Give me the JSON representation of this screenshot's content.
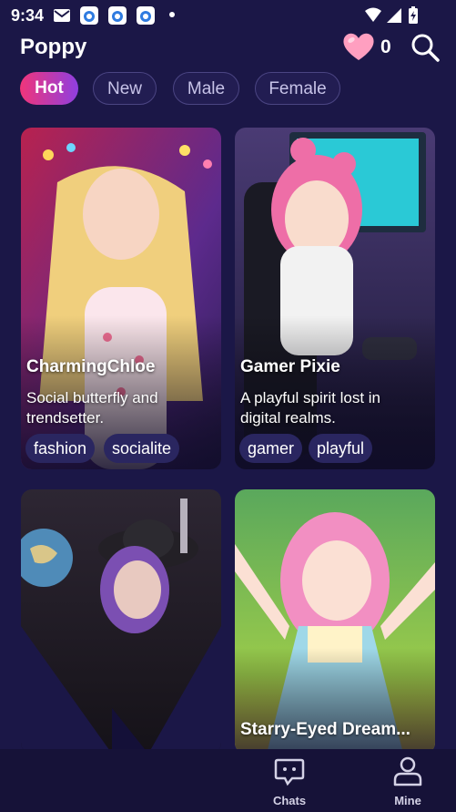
{
  "status_bar": {
    "time": "9:34"
  },
  "header": {
    "title": "Poppy",
    "heart_count": "0"
  },
  "tabs": [
    {
      "label": "Hot"
    },
    {
      "label": "New"
    },
    {
      "label": "Male"
    },
    {
      "label": "Female"
    }
  ],
  "cards": [
    {
      "name": "CharmingChloe",
      "description": "Social butterfly and trendsetter.",
      "tags": [
        "fashion",
        "socialite"
      ]
    },
    {
      "name": "Gamer Pixie",
      "description": "A playful spirit lost in digital realms.",
      "tags": [
        "gamer",
        "playful"
      ]
    },
    {
      "name": "",
      "description": "",
      "tags": []
    },
    {
      "name": "Starry-Eyed Dream...",
      "description": "",
      "tags": []
    }
  ],
  "bottom_nav": [
    {
      "label": "Chats",
      "icon": "chat-icon"
    },
    {
      "label": "Mine",
      "icon": "person-icon"
    }
  ],
  "colors": {
    "background": "#1b1747",
    "tab_active_start": "#f0357a",
    "tab_active_end": "#8f3fe0",
    "heart": "#ff8fb5",
    "tag_bg": "#2a2660"
  }
}
